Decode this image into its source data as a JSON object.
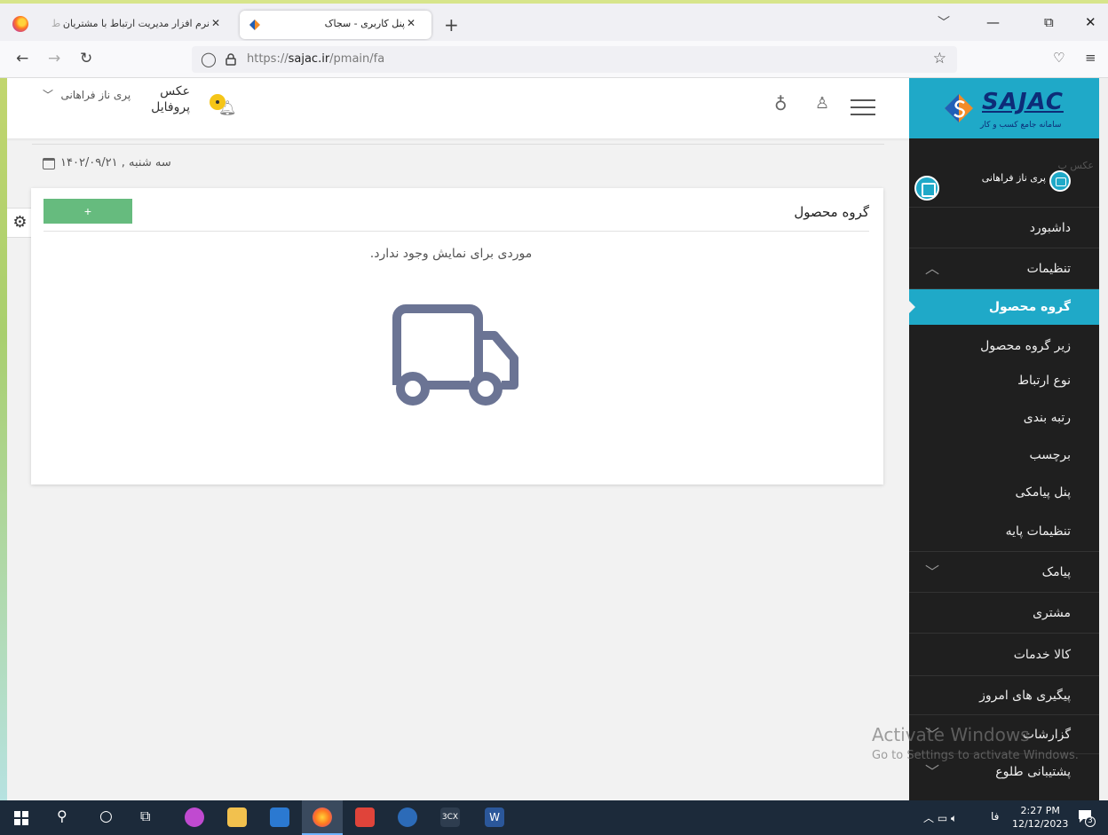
{
  "browser": {
    "tabs": [
      {
        "title": "نرم افزار مدیریت ارتباط با مشتریان",
        "extra": "ط",
        "active": false
      },
      {
        "title": "پنل کاربری - سجاک",
        "active": true
      }
    ],
    "url_prefix": "https://",
    "url_domain": "sajac.ir",
    "url_path": "/pmain/fa",
    "new_tab": "+",
    "minimize": "—",
    "restore": "⧉",
    "close": "✕"
  },
  "header": {
    "avatar_alt_line1": "عکس",
    "avatar_alt_line2": "پروفایل",
    "user_name": "پری ناز فراهانی",
    "user_chevron": "﹀"
  },
  "date": "سه شنبه , ۱۴۰۲/۰۹/۲۱",
  "card": {
    "title": "گروه محصول",
    "add_label": "+",
    "empty_message": "موردی برای نمایش وجود ندارد."
  },
  "sidebar": {
    "logo_text": "SAJAC",
    "logo_subtitle": "سامانه جامع کسب و کار",
    "profile_name": "پری ناز فراهانی",
    "ghost_text": "عکس پ",
    "items": [
      {
        "label": "داشبورد"
      },
      {
        "label": "تنظیمات",
        "arrow": "︿"
      },
      {
        "label": "گروه محصول",
        "active": true
      },
      {
        "label": "زیر گروه محصول"
      },
      {
        "label": "نوع ارتباط"
      },
      {
        "label": "رتبه بندی"
      },
      {
        "label": "برچسب"
      },
      {
        "label": "پنل پیامکی"
      },
      {
        "label": "تنظیمات پایه"
      },
      {
        "label": "پیامک",
        "arrow": "﹀"
      },
      {
        "label": "مشتری"
      },
      {
        "label": "کالا خدمات"
      },
      {
        "label": "پیگیری های امروز"
      },
      {
        "label": "گزارشات",
        "arrow": "﹀"
      },
      {
        "label": "پشتیبانی طلوع",
        "arrow": "﹀"
      }
    ]
  },
  "watermark": {
    "line1": "Activate Windows",
    "line2": "Go to Settings to activate Windows."
  },
  "taskbar": {
    "lang": "فا",
    "time": "2:27 PM",
    "date": "12/12/2023",
    "notif_count": "3"
  },
  "colors": {
    "accent": "#1fa9c8",
    "sidebar_bg": "#1f1f1f",
    "add_button": "#66bb7e",
    "logo_text": "#0d2c78"
  }
}
